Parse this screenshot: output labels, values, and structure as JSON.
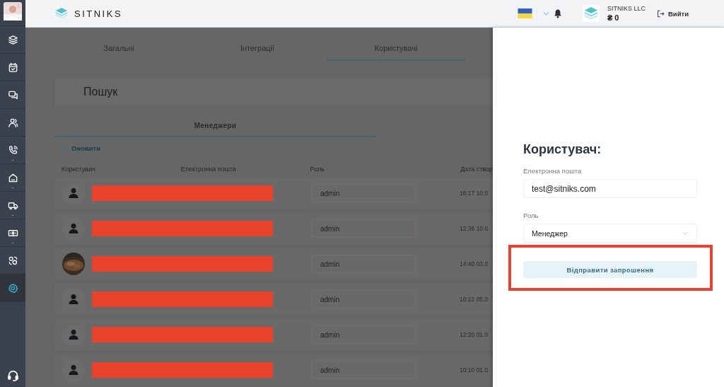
{
  "header": {
    "brand": "SITNIKS",
    "company": "SITNIKS LLC",
    "balance": "₴ 0",
    "logout": "Вийти"
  },
  "sidebar": {
    "items": [
      {
        "selected": false,
        "expandable": false
      },
      {
        "selected": false,
        "expandable": false
      },
      {
        "selected": false,
        "expandable": false
      },
      {
        "selected": false,
        "expandable": false
      },
      {
        "selected": false,
        "expandable": true
      },
      {
        "selected": false,
        "expandable": true
      },
      {
        "selected": false,
        "expandable": true
      },
      {
        "selected": false,
        "expandable": true
      },
      {
        "selected": false,
        "expandable": false
      },
      {
        "selected": true,
        "expandable": false
      }
    ]
  },
  "tabs": [
    {
      "label": "Загальні",
      "selected": false
    },
    {
      "label": "Інтеграції",
      "selected": false
    },
    {
      "label": "Користувачі",
      "selected": true
    }
  ],
  "search": {
    "placeholder": "Пошук"
  },
  "subtabs": [
    {
      "label": "Менеджери",
      "selected": true
    }
  ],
  "refresh": "Оновити",
  "table": {
    "columns": [
      "Користувач",
      "Електронна пошта",
      "Роль",
      "Дата створ"
    ],
    "rows": [
      {
        "kind": "person",
        "redacted": true,
        "role": "admin",
        "created": "16:17 10.0"
      },
      {
        "kind": "person",
        "redacted": true,
        "role": "admin",
        "created": "12:36 10.0"
      },
      {
        "kind": "picture",
        "redacted": true,
        "role": "admin",
        "created": "14:40 03.0"
      },
      {
        "kind": "person",
        "redacted": true,
        "role": "admin",
        "created": "10:22 05.0"
      },
      {
        "kind": "person",
        "redacted": true,
        "role": "admin",
        "created": "12:20 01.0"
      },
      {
        "kind": "person",
        "redacted": true,
        "role": "admin",
        "created": "10:10 01.0"
      }
    ]
  },
  "panel": {
    "title": "Користувач:",
    "email_label": "Електронна пошта",
    "email_value": "test@sitniks.com",
    "role_label": "Роль",
    "role_value": "Менеджер",
    "invite_button": {
      "label": "Відправити запрошення",
      "highlighted": true
    }
  }
}
